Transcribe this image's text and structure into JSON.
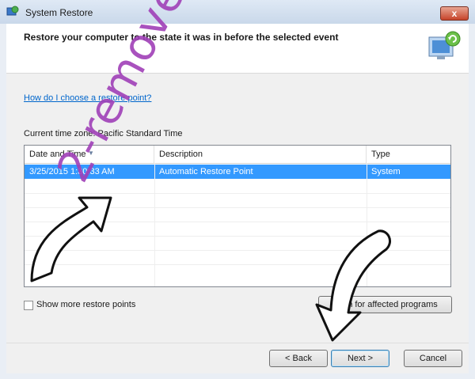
{
  "window": {
    "title": "System Restore",
    "close_glyph": "x"
  },
  "header": {
    "heading": "Restore your computer to the state it was in before the selected event",
    "icon": "system-restore-icon"
  },
  "main": {
    "help_link": "How do I choose a restore point?",
    "time_zone": "Current time zone: Pacific Standard Time",
    "table": {
      "columns": [
        "Date and Time",
        "Description",
        "Type"
      ],
      "rows": [
        {
          "date": "3/25/2015 1:30:33 AM",
          "description": "Automatic Restore Point",
          "type": "System"
        }
      ]
    },
    "show_more_label": "Show more restore points",
    "scan_button": "Scan for affected programs"
  },
  "footer": {
    "back": "< Back",
    "next": "Next >",
    "cancel": "Cancel"
  },
  "overlay": {
    "watermark": "2-remove-virus.com"
  },
  "colors": {
    "selection": "#3399ff",
    "link": "#0066cc",
    "watermark": "#a040b8"
  }
}
